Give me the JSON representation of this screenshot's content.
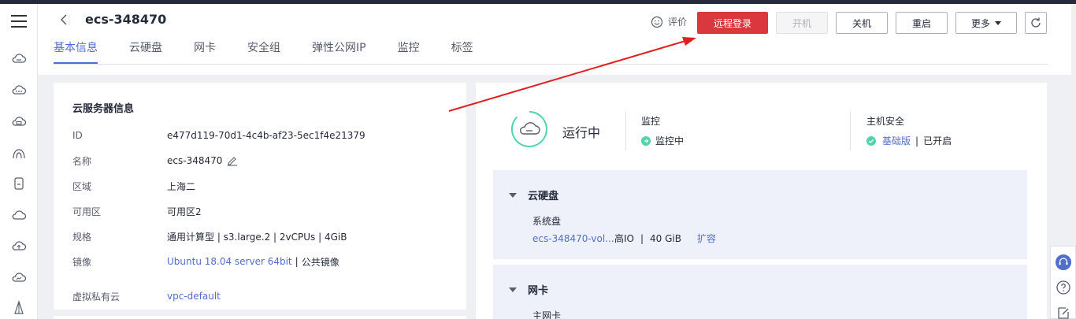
{
  "header": {
    "title": "ecs-348470",
    "rate_label": "评价",
    "buttons": {
      "remote_login": "远程登录",
      "start": "开机",
      "stop": "关机",
      "restart": "重启",
      "more": "更多"
    }
  },
  "tabs": [
    {
      "label": "基本信息",
      "active": true
    },
    {
      "label": "云硬盘",
      "active": false
    },
    {
      "label": "网卡",
      "active": false
    },
    {
      "label": "安全组",
      "active": false
    },
    {
      "label": "弹性公网IP",
      "active": false
    },
    {
      "label": "监控",
      "active": false
    },
    {
      "label": "标签",
      "active": false
    }
  ],
  "server_info": {
    "title": "云服务器信息",
    "id_label": "ID",
    "id_value": "e477d119-70d1-4c4b-af23-5ec1f4e21379",
    "name_label": "名称",
    "name_value": "ecs-348470",
    "region_label": "区域",
    "region_value": "上海二",
    "az_label": "可用区",
    "az_value": "可用区2",
    "spec_label": "规格",
    "spec_value": "通用计算型 | s3.large.2 | 2vCPUs | 4GiB",
    "image_label": "镜像",
    "image_link": "Ubuntu 18.04 server 64bit",
    "image_sep": "|",
    "image_type": "公共镜像",
    "vpc_label": "虚拟私有云",
    "vpc_value": "vpc-default"
  },
  "status_panel": {
    "status": "运行中",
    "monitor_title": "监控",
    "monitor_value": "监控中",
    "security_title": "主机安全",
    "security_link": "基础版",
    "security_sep": "|",
    "security_value": "已开启"
  },
  "disks": {
    "title": "云硬盘",
    "system_disk_label": "系统盘",
    "disk_name": "ecs-348470-vol...",
    "disk_type": "高IO",
    "disk_sep": "|",
    "disk_size": "40 GiB",
    "expand_label": "扩容"
  },
  "nics": {
    "title": "网卡",
    "primary_label": "主网卡"
  },
  "colors": {
    "primary_red": "#d9383e",
    "link_blue": "#526ecc",
    "status_green": "#50d4ab",
    "annotation_red": "#e02020"
  }
}
